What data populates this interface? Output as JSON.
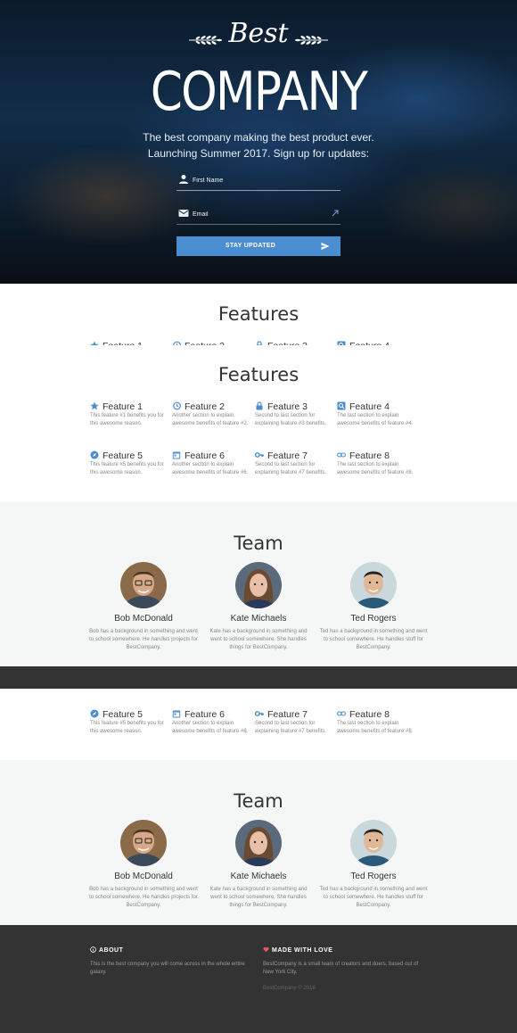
{
  "hero": {
    "script_title": "Best",
    "title": "COMPANY",
    "tagline_line1": "The best company making the best product ever.",
    "tagline_line2": "Launching Summer 2017. Sign up for updates:",
    "first_name_placeholder": "First Name",
    "email_placeholder": "Email",
    "submit_label": "STAY UPDATED"
  },
  "features": {
    "title": "Features",
    "items": [
      {
        "title": "Feature 1",
        "icon": "star-icon",
        "description": "This feature #1 benefits you for this awesome reason."
      },
      {
        "title": "Feature 2",
        "icon": "history-icon",
        "description": "Another section to explain awesome benefits of feature #2."
      },
      {
        "title": "Feature 3",
        "icon": "lock-icon",
        "description": "Second to last section for explaining feature #3 benefits."
      },
      {
        "title": "Feature 4",
        "icon": "search-icon",
        "description": "The last section to explain awesome benefits of feature #4."
      },
      {
        "title": "Feature 5",
        "icon": "explore-icon",
        "description": "This feature #5 benefits you for this awesome reason."
      },
      {
        "title": "Feature 6",
        "icon": "calendar-icon",
        "description": "Another section to explain awesome benefits of feature #6."
      },
      {
        "title": "Feature 7",
        "icon": "key-icon",
        "description": "Second to last section for explaining feature #7 benefits."
      },
      {
        "title": "Feature 8",
        "icon": "link-icon",
        "description": "The last section to explain awesome benefits of feature #8."
      }
    ]
  },
  "team": {
    "title": "Team",
    "members": [
      {
        "name": "Bob McDonald",
        "bio": "Bob has a background in something and went to school somewhere. He handles projects for BestCompany."
      },
      {
        "name": "Kate Michaels",
        "bio": "Kate has a background in something and went to school somewhere. She handles things for BestCompany."
      },
      {
        "name": "Ted Rogers",
        "bio": "Ted has a background in something and went to school somewhere. He handles stuff for BestCompany."
      }
    ]
  },
  "footer": {
    "about_title": "ABOUT",
    "about_text": "This is the best company you will come across in the whole entire galaxy.",
    "love_title": "MADE WITH LOVE",
    "love_text": "BestCompany is a small team of creators and doers, based out of New York City.",
    "copyright": "BestCompany © 2016"
  },
  "colors": {
    "accent": "#4a8dd0",
    "dark": "#333333",
    "team_bg": "#f5f6f6",
    "heart": "#e05a5a"
  }
}
